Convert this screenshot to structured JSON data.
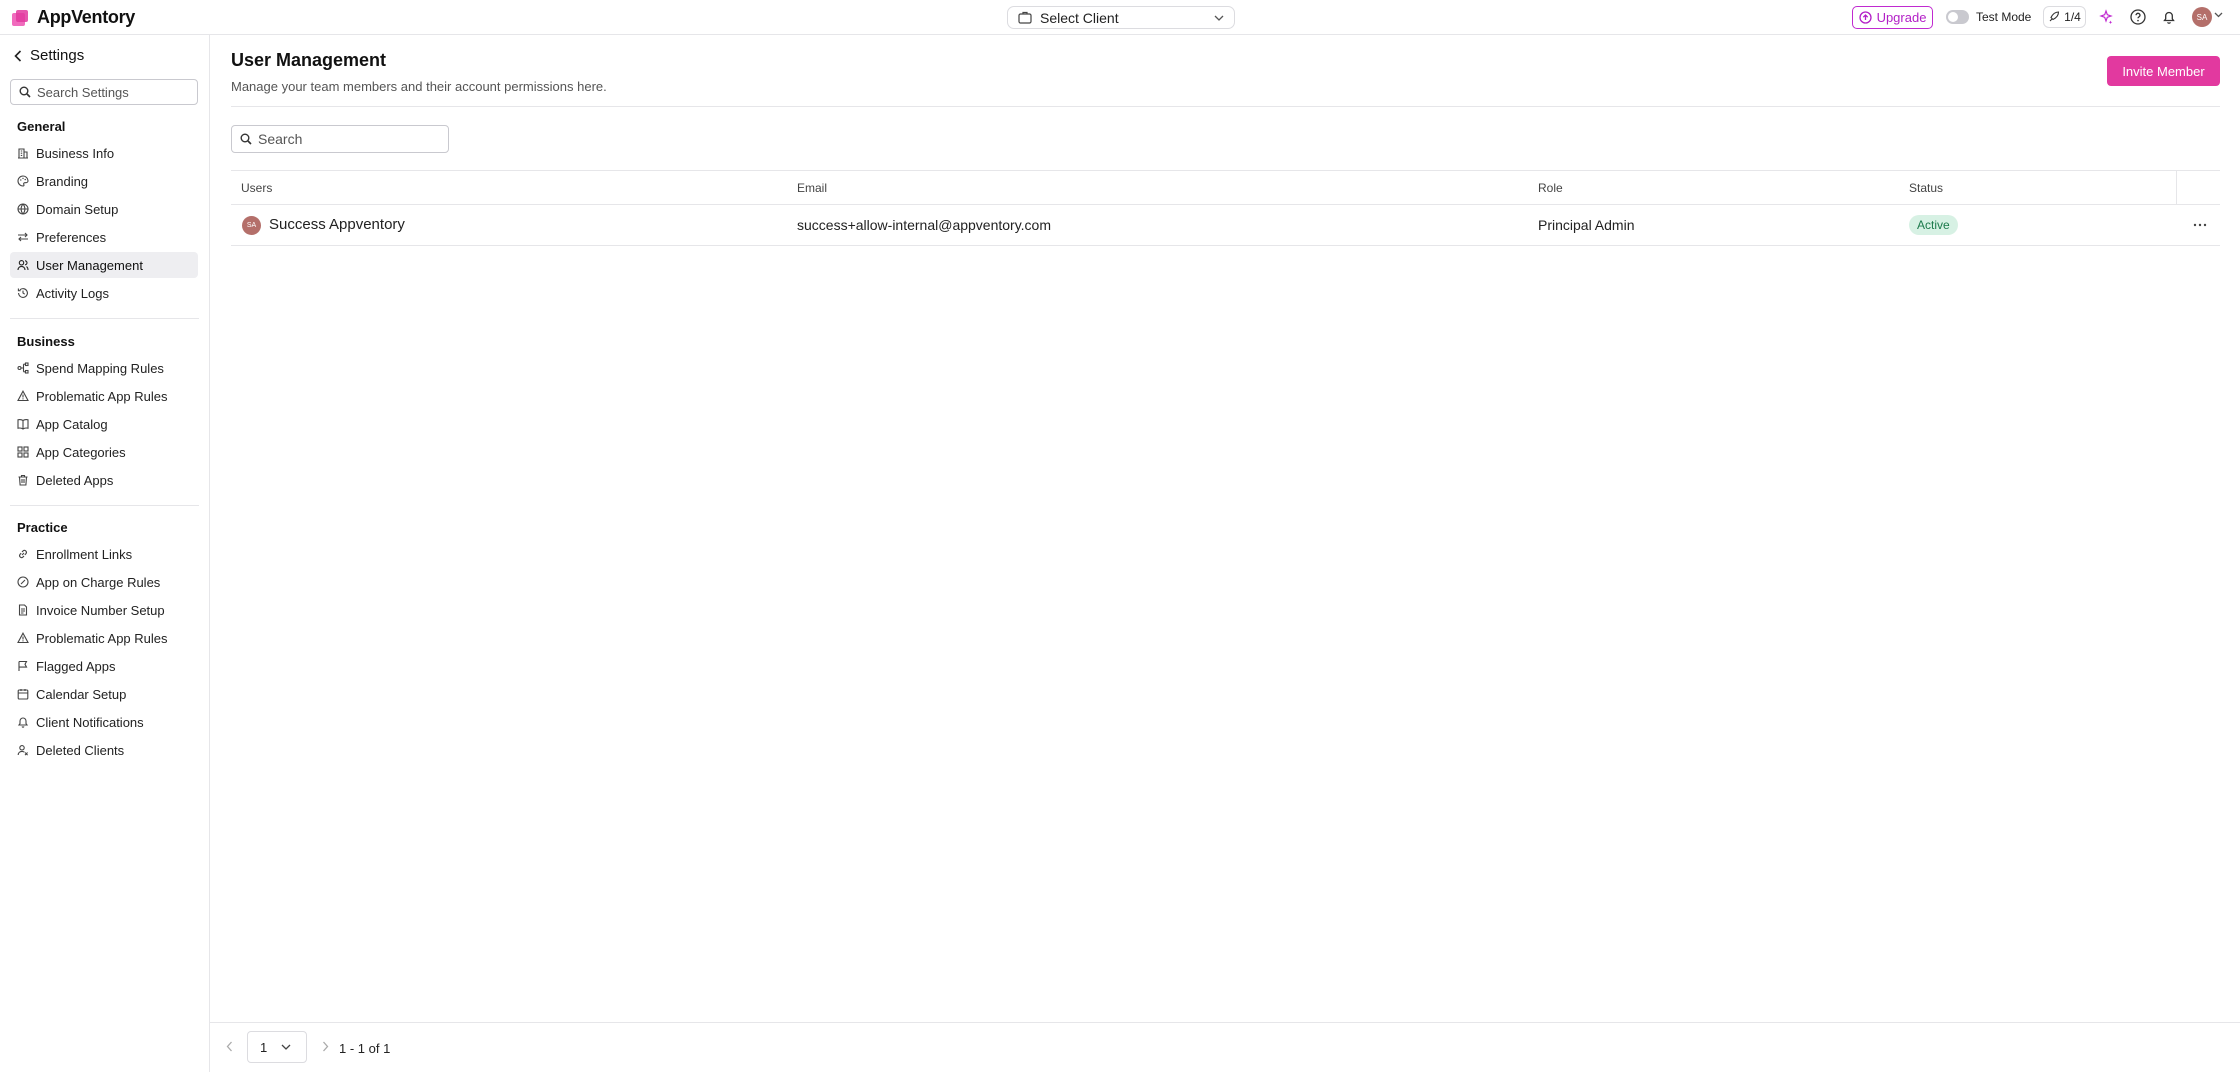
{
  "app": {
    "name": "AppVentory"
  },
  "topbar": {
    "client_select_label": "Select Client",
    "upgrade_label": "Upgrade",
    "test_mode_label": "Test Mode",
    "test_mode_on": false,
    "counter_label": "1/4",
    "avatar_initials": "SA",
    "icons": [
      "sparkle-icon",
      "help-icon",
      "bell-icon"
    ]
  },
  "sidebar": {
    "back_label": "Settings",
    "search_placeholder": "Search Settings",
    "sections": [
      {
        "title": "General",
        "items": [
          {
            "label": "Business Info",
            "icon": "building-icon"
          },
          {
            "label": "Branding",
            "icon": "palette-icon"
          },
          {
            "label": "Domain Setup",
            "icon": "globe-icon"
          },
          {
            "label": "Preferences",
            "icon": "arrows-icon"
          },
          {
            "label": "User Management",
            "icon": "users-icon",
            "active": true
          },
          {
            "label": "Activity Logs",
            "icon": "history-icon"
          }
        ]
      },
      {
        "title": "Business",
        "items": [
          {
            "label": "Spend Mapping Rules",
            "icon": "mapping-icon"
          },
          {
            "label": "Problematic App Rules",
            "icon": "warning-icon"
          },
          {
            "label": "App Catalog",
            "icon": "book-icon"
          },
          {
            "label": "App Categories",
            "icon": "grid-icon"
          },
          {
            "label": "Deleted Apps",
            "icon": "trash-icon"
          }
        ]
      },
      {
        "title": "Practice",
        "items": [
          {
            "label": "Enrollment Links",
            "icon": "link-icon"
          },
          {
            "label": "App on Charge Rules",
            "icon": "coin-icon"
          },
          {
            "label": "Invoice Number Setup",
            "icon": "document-icon"
          },
          {
            "label": "Problematic App Rules",
            "icon": "warning-icon"
          },
          {
            "label": "Flagged Apps",
            "icon": "flag-icon"
          },
          {
            "label": "Calendar Setup",
            "icon": "calendar-icon"
          },
          {
            "label": "Client Notifications",
            "icon": "bell-icon"
          },
          {
            "label": "Deleted Clients",
            "icon": "user-x-icon"
          }
        ]
      }
    ]
  },
  "main": {
    "title": "User Management",
    "subtitle": "Manage your team members and their account permissions here.",
    "invite_label": "Invite Member",
    "search_placeholder": "Search",
    "table": {
      "columns": [
        "Users",
        "Email",
        "Role",
        "Status"
      ],
      "rows": [
        {
          "avatar": "SA",
          "name": "Success Appventory",
          "email": "success+allow-internal@appventory.com",
          "role": "Principal Admin",
          "status": "Active"
        }
      ]
    }
  },
  "pagination": {
    "page": "1",
    "range": "1 - 1 of 1"
  },
  "colors": {
    "brand_pink": "#e2399f",
    "upgrade_purple": "#b320c7",
    "status_active_bg": "#d7f1e4",
    "status_active_text": "#1c7a4b",
    "avatar_bg": "#b46f6a"
  }
}
